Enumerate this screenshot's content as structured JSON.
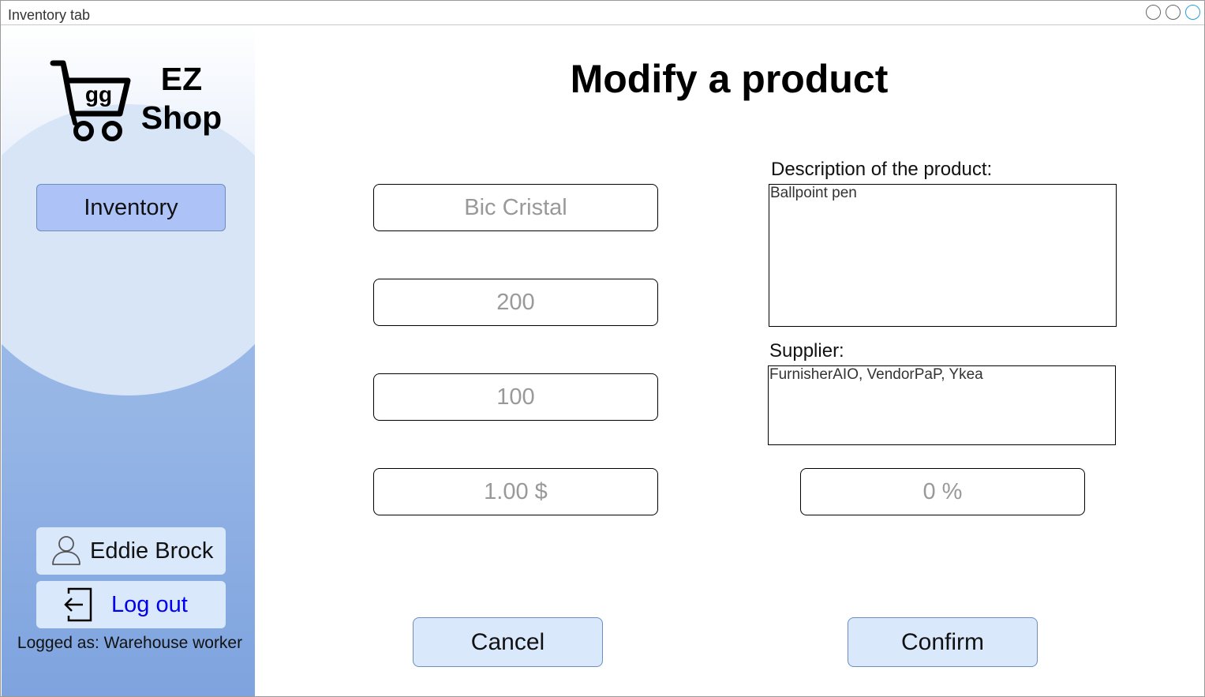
{
  "window": {
    "title": "Inventory tab"
  },
  "sidebar": {
    "logo": {
      "line1": "EZ",
      "line2": "Shop",
      "cart_text": "gg"
    },
    "nav": {
      "inventory_label": "Inventory"
    },
    "user": {
      "name": "Eddie Brock"
    },
    "logout_label": "Log out",
    "logged_as": "Logged as: Warehouse worker"
  },
  "main": {
    "title": "Modify a product",
    "fields": {
      "product_name": "Bic Cristal",
      "quantity": "200",
      "position": "100",
      "price": "1.00 $",
      "discount": "0 %"
    },
    "description_label": "Description of the product:",
    "description_value": "Ballpoint pen",
    "supplier_label": "Supplier:",
    "supplier_value": "FurnisherAIO, VendorPaP, Ykea",
    "cancel_label": "Cancel",
    "confirm_label": "Confirm"
  },
  "colors": {
    "nav_active": "#adc3f8",
    "button_bg": "#dae8fc",
    "button_border": "#6c8ebf",
    "link": "#0000ee",
    "placeholder_text": "#999999"
  }
}
